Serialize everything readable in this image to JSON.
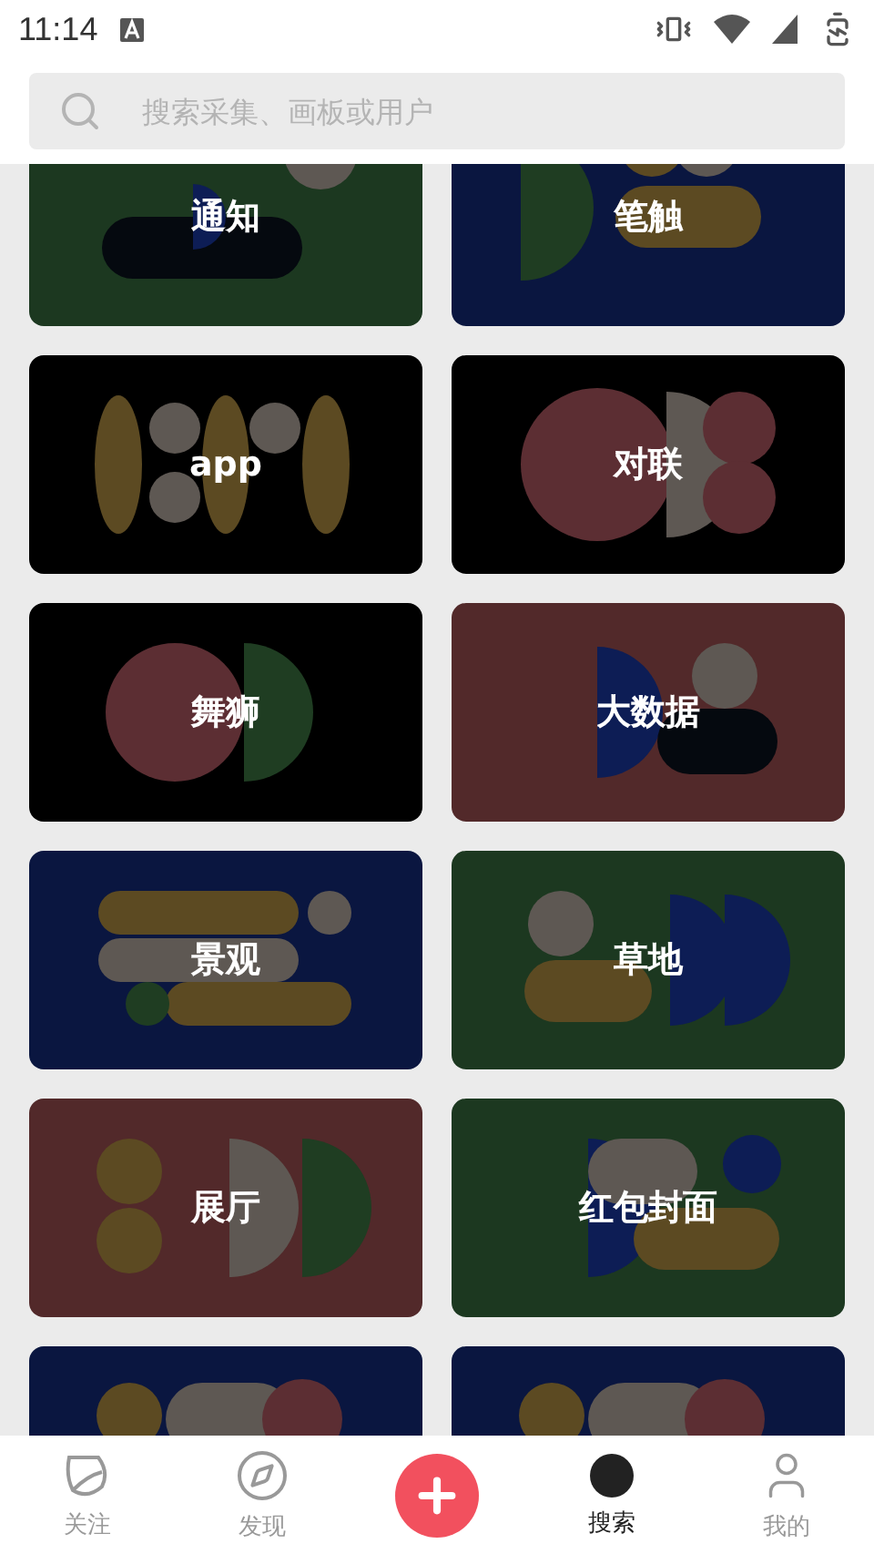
{
  "status_bar": {
    "time": "11:14"
  },
  "search": {
    "placeholder": "搜索采集、画板或用户"
  },
  "tiles": [
    {
      "label": "通知",
      "color": "#1c3820"
    },
    {
      "label": "笔触",
      "color": "#0a1640"
    },
    {
      "label": "app",
      "color": "#000000"
    },
    {
      "label": "对联",
      "color": "#000000"
    },
    {
      "label": "舞狮",
      "color": "#000000"
    },
    {
      "label": "大数据",
      "color": "#52292a"
    },
    {
      "label": "景观",
      "color": "#0a1640"
    },
    {
      "label": "草地",
      "color": "#1c3820"
    },
    {
      "label": "展厅",
      "color": "#52292a"
    },
    {
      "label": "红包封面",
      "color": "#1c3820"
    },
    {
      "color": "#0a1640"
    },
    {
      "color": "#0a1640"
    }
  ],
  "bottom_nav": [
    {
      "kind": "leaf",
      "label": "关注",
      "selected": false
    },
    {
      "kind": "compass",
      "label": "发现",
      "selected": false
    },
    {
      "kind": "add"
    },
    {
      "kind": "dot",
      "label": "搜索",
      "selected": true
    },
    {
      "kind": "user",
      "label": "我的",
      "selected": false
    }
  ]
}
